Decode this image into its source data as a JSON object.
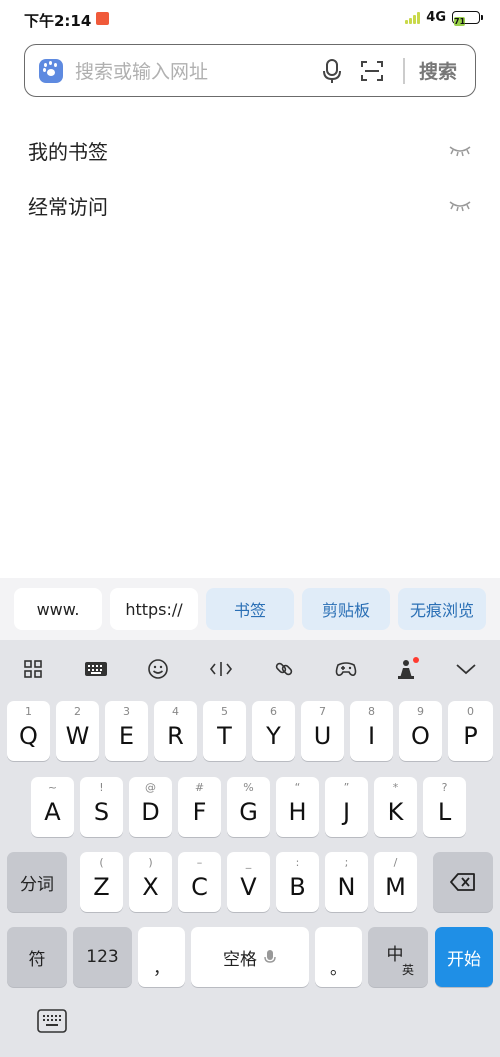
{
  "status": {
    "time": "下午2:14",
    "network": "4G",
    "battery": "71"
  },
  "search": {
    "placeholder": "搜索或输入网址",
    "button": "搜索"
  },
  "sections": [
    {
      "label": "我的书签"
    },
    {
      "label": "经常访问"
    }
  ],
  "candidates": [
    "www.",
    "https://",
    "书签",
    "剪贴板",
    "无痕浏览"
  ],
  "toolbar_icons": [
    "grid-icon",
    "keyboard-layout-icon",
    "emoji-icon",
    "cursor-icon",
    "link-icon",
    "gamepad-icon",
    "skin-icon",
    "collapse-chevron-icon"
  ],
  "keyboard": {
    "row1": [
      {
        "main": "Q",
        "sub": "1"
      },
      {
        "main": "W",
        "sub": "2"
      },
      {
        "main": "E",
        "sub": "3"
      },
      {
        "main": "R",
        "sub": "4"
      },
      {
        "main": "T",
        "sub": "5"
      },
      {
        "main": "Y",
        "sub": "6"
      },
      {
        "main": "U",
        "sub": "7"
      },
      {
        "main": "I",
        "sub": "8"
      },
      {
        "main": "O",
        "sub": "9"
      },
      {
        "main": "P",
        "sub": "0"
      }
    ],
    "row2": [
      {
        "main": "A",
        "sub": "~"
      },
      {
        "main": "S",
        "sub": "!"
      },
      {
        "main": "D",
        "sub": "@"
      },
      {
        "main": "F",
        "sub": "#"
      },
      {
        "main": "G",
        "sub": "%"
      },
      {
        "main": "H",
        "sub": "“"
      },
      {
        "main": "J",
        "sub": "”"
      },
      {
        "main": "K",
        "sub": "*"
      },
      {
        "main": "L",
        "sub": "?"
      }
    ],
    "row3": [
      {
        "main": "Z",
        "sub": "("
      },
      {
        "main": "X",
        "sub": ")"
      },
      {
        "main": "C",
        "sub": "–"
      },
      {
        "main": "V",
        "sub": "_"
      },
      {
        "main": "B",
        "sub": ":"
      },
      {
        "main": "N",
        "sub": ";"
      },
      {
        "main": "M",
        "sub": "/"
      }
    ],
    "segment_label": "分词",
    "symbol_label": "符",
    "number_label": "123",
    "comma_label": "，",
    "space_label": "空格",
    "period_label": "。",
    "lang_main": "中",
    "lang_sub": "英",
    "enter_label": "开始"
  },
  "colors": {
    "accent": "#1f8fe6",
    "chip_blue_text": "#2a6fb5",
    "chip_blue_bg": "#e0ecf8"
  }
}
